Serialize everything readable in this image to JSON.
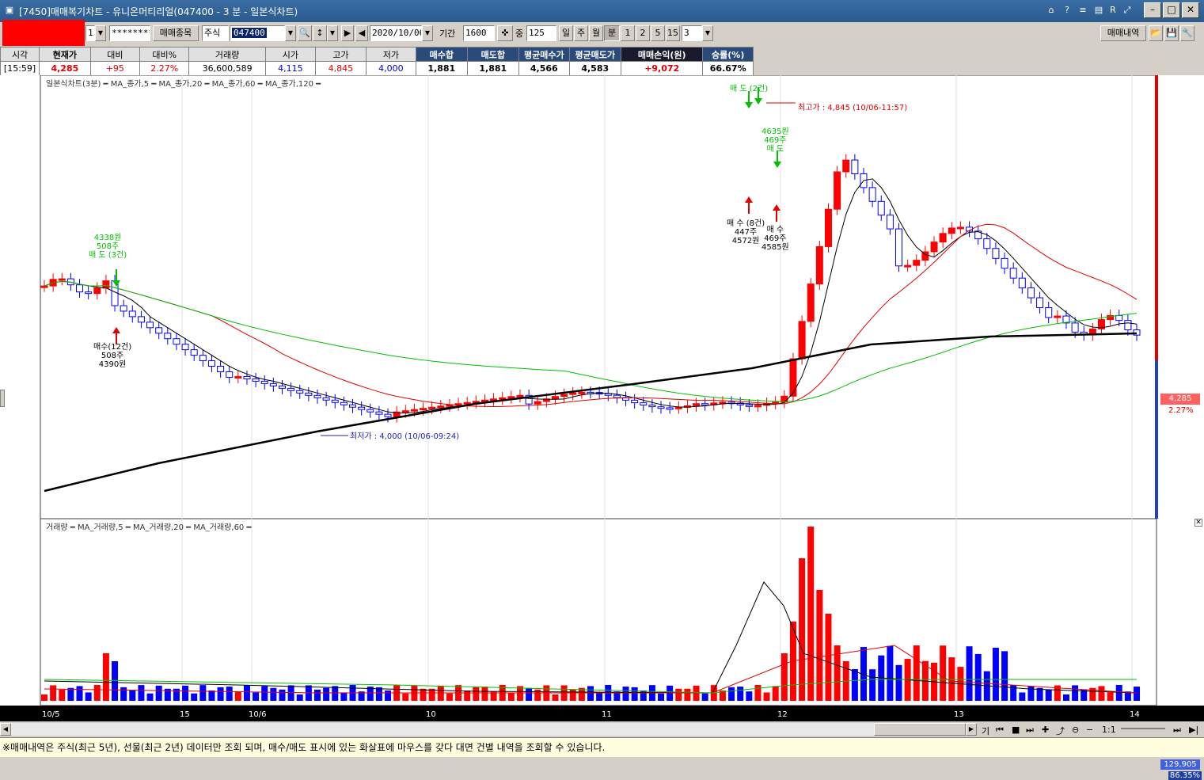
{
  "window": {
    "title": "[7450]매매복기차트 - 유니온머티리얼(047400 - 3 분 - 일본식차트)"
  },
  "toolbar": {
    "account_suffix": "1",
    "password": "********",
    "trade_items_btn": "매매종목",
    "market_type": "주식",
    "stock_code": "047400",
    "date": "2020/10/06",
    "period_label": "기간",
    "period_value": "1600",
    "count_label": "중",
    "count_value": "125",
    "periods": [
      "일",
      "주",
      "월",
      "분",
      "1",
      "2",
      "5",
      "15"
    ],
    "interval": "3",
    "history_btn": "매매내역"
  },
  "info": {
    "headers": [
      "시각",
      "현재가",
      "대비",
      "대비%",
      "거래량",
      "시가",
      "고가",
      "저가",
      "매수합",
      "매도합",
      "평균매수가",
      "평균매도가",
      "매매손익(원)",
      "승률(%)"
    ],
    "values": [
      "[15:59]",
      "4,285",
      "+95",
      "2.27%",
      "36,600,589",
      "4,115",
      "4,845",
      "4,000",
      "1,881",
      "1,881",
      "4,566",
      "4,583",
      "+9,072",
      "66.67%"
    ]
  },
  "price_chart": {
    "legend": "일본식차트(3분) ━ MA_종가,5 ━ MA_종가,20 ━ MA_종가,60 ━ MA_종가,120 ━",
    "high_label": "최고가 : 4,845 (10/06-11:57)",
    "low_label": "최저가 : 4,000 (10/06-09:24)",
    "current_price": "4,285",
    "current_pct": "2.27%",
    "annotations": [
      {
        "lines": [
          "4338원",
          "508주",
          "매 도 (3건)"
        ],
        "color": "#00c000"
      },
      {
        "lines": [
          "매수(12건)",
          "508주",
          "4390원"
        ],
        "color": "#000"
      },
      {
        "lines": [
          "매 수 (8건)",
          "447주",
          "4572원"
        ],
        "color": "#000"
      },
      {
        "lines": [
          "매 수",
          "469주",
          "4585원"
        ],
        "color": "#000"
      },
      {
        "lines": [
          "4635원",
          "469주",
          "매 도"
        ],
        "color": "#00c000"
      },
      {
        "lines": [
          "매 도 (2건)"
        ],
        "color": "#00c000"
      }
    ]
  },
  "volume_chart": {
    "legend": "거래량 ━ MA_거래량,5 ━ MA_거래량,20 ━ MA_거래량,60 ━",
    "last_value": "129,905",
    "last_pct": "86.35%"
  },
  "x_axis": {
    "labels": [
      "10/5",
      "15",
      "10/6",
      "10",
      "11",
      "12",
      "13",
      "14"
    ]
  },
  "scroll": {
    "zoom": "1:1"
  },
  "status": {
    "text": "※매매내역은 주식(최근 5년), 선물(최근 2년) 데이터만 조회 되며, 매수/매도 표시에 있는 화살표에 마우스를 갖다 대면 건별 내역을 조회할 수 있습니다."
  },
  "colors": {
    "up": "#ff0000",
    "down": "#0000ff",
    "ma5": "#000000",
    "ma20": "#e00000",
    "ma60": "#00c000",
    "ma120": "#000000"
  }
}
